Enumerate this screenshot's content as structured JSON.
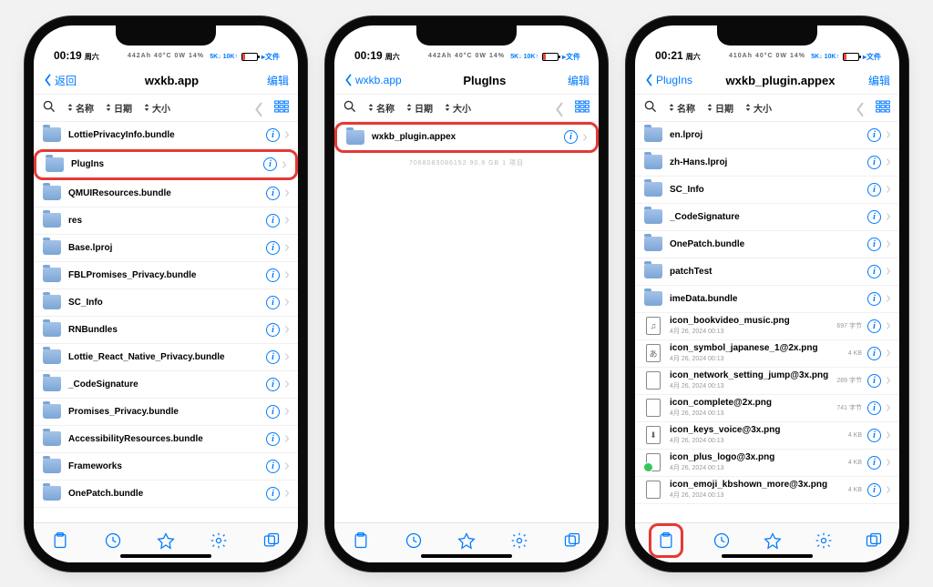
{
  "phones": [
    {
      "status": {
        "time": "00:19",
        "day": "周六",
        "sub": "442Ah   40°C   0W   14%",
        "net": "5K↓ 10K↑"
      },
      "nav": {
        "back": "返回",
        "title": "wxkb.app",
        "edit": "编辑"
      },
      "sort": {
        "c1": "名称",
        "c2": "日期",
        "c3": "大小"
      },
      "rows": [
        {
          "type": "folder",
          "name": "LottiePrivacyInfo.bundle",
          "hl": false
        },
        {
          "type": "folder",
          "name": "PlugIns",
          "hl": true
        },
        {
          "type": "folder",
          "name": "QMUIResources.bundle",
          "hl": false
        },
        {
          "type": "folder",
          "name": "res",
          "hl": false
        },
        {
          "type": "folder",
          "name": "Base.lproj",
          "hl": false
        },
        {
          "type": "folder",
          "name": "FBLPromises_Privacy.bundle",
          "hl": false
        },
        {
          "type": "folder",
          "name": "SC_Info",
          "hl": false
        },
        {
          "type": "folder",
          "name": "RNBundles",
          "hl": false
        },
        {
          "type": "folder",
          "name": "Lottie_React_Native_Privacy.bundle",
          "hl": false
        },
        {
          "type": "folder",
          "name": "_CodeSignature",
          "hl": false
        },
        {
          "type": "folder",
          "name": "Promises_Privacy.bundle",
          "hl": false
        },
        {
          "type": "folder",
          "name": "AccessibilityResources.bundle",
          "hl": false
        },
        {
          "type": "folder",
          "name": "Frameworks",
          "hl": false
        },
        {
          "type": "folder",
          "name": "OnePatch.bundle",
          "hl": false
        }
      ],
      "hint": "",
      "tab_hl": false
    },
    {
      "status": {
        "time": "00:19",
        "day": "周六",
        "sub": "442Ah   40°C   0W   14%",
        "net": "5K↓ 10K↑"
      },
      "nav": {
        "back": "wxkb.app",
        "title": "PlugIns",
        "edit": "编辑"
      },
      "sort": {
        "c1": "名称",
        "c2": "日期",
        "c3": "大小"
      },
      "rows": [
        {
          "type": "folder",
          "name": "wxkb_plugin.appex",
          "hl": true
        }
      ],
      "hint": "7068083086152   90.9 GB   1 项目",
      "tab_hl": false
    },
    {
      "status": {
        "time": "00:21",
        "day": "周六",
        "sub": "410Ah   40°C   0W   14%",
        "net": "5K↓ 10K↑"
      },
      "nav": {
        "back": "PlugIns",
        "title": "wxkb_plugin.appex",
        "edit": "编辑"
      },
      "sort": {
        "c1": "名称",
        "c2": "日期",
        "c3": "大小"
      },
      "rows": [
        {
          "type": "folder",
          "name": "en.lproj",
          "hl": false
        },
        {
          "type": "folder",
          "name": "zh-Hans.lproj",
          "hl": false
        },
        {
          "type": "folder",
          "name": "SC_Info",
          "hl": false
        },
        {
          "type": "folder",
          "name": "_CodeSignature",
          "hl": false
        },
        {
          "type": "folder",
          "name": "OnePatch.bundle",
          "hl": false
        },
        {
          "type": "folder",
          "name": "patchTest",
          "hl": false
        },
        {
          "type": "folder",
          "name": "imeData.bundle",
          "hl": false
        },
        {
          "type": "file",
          "glyph": "♫",
          "name": "icon_bookvideo_music.png",
          "sub": "4月 26, 2024 00:13",
          "meta": "697 字节",
          "hl": false
        },
        {
          "type": "file",
          "glyph": "あ",
          "name": "icon_symbol_japanese_1@2x.png",
          "sub": "4月 26, 2024 00:13",
          "meta": "4 KB",
          "hl": false
        },
        {
          "type": "file",
          "glyph": "",
          "name": "icon_network_setting_jump@3x.png",
          "sub": "4月 26, 2024 00:13",
          "meta": "289 字节",
          "hl": false
        },
        {
          "type": "file",
          "glyph": "",
          "name": "icon_complete@2x.png",
          "sub": "4月 26, 2024 00:13",
          "meta": "741 字节",
          "hl": false
        },
        {
          "type": "file",
          "glyph": "⬇",
          "name": "icon_keys_voice@3x.png",
          "sub": "4月 26, 2024 00:13",
          "meta": "4 KB",
          "hl": false
        },
        {
          "type": "file",
          "glyph": "",
          "green": true,
          "name": "icon_plus_logo@3x.png",
          "sub": "4月 26, 2024 00:13",
          "meta": "4 KB",
          "hl": false
        },
        {
          "type": "file",
          "glyph": "",
          "name": "icon_emoji_kbshown_more@3x.png",
          "sub": "4月 26, 2024 00:13",
          "meta": "4 KB",
          "hl": false
        }
      ],
      "hint": "",
      "tab_hl": true
    }
  ],
  "icons": {
    "info": "i"
  }
}
